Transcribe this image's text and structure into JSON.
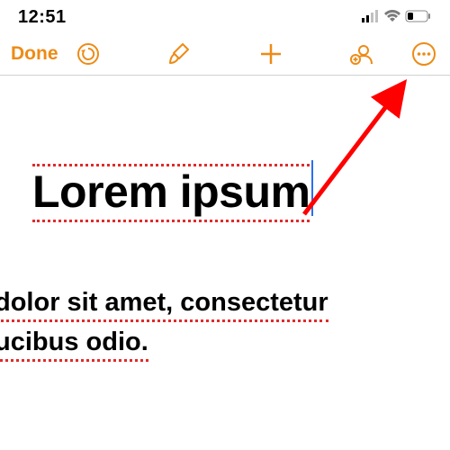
{
  "status": {
    "time": "12:51"
  },
  "toolbar": {
    "done_label": "Done"
  },
  "icons": {
    "undo": "undo-icon",
    "brush": "brush-icon",
    "plus": "plus-icon",
    "share": "share-icon",
    "more": "more-icon",
    "signal": "signal-icon",
    "wifi": "wifi-icon",
    "battery": "battery-icon"
  },
  "document": {
    "title": "Lorem ipsum",
    "body_line1": " dolor sit amet, consectetur",
    "body_line2": "ucibus odio."
  },
  "colors": {
    "accent": "#ed8b16",
    "spellcheck": "#e12a2a",
    "cursor": "#2a6ff0",
    "arrow": "#ff0000"
  }
}
